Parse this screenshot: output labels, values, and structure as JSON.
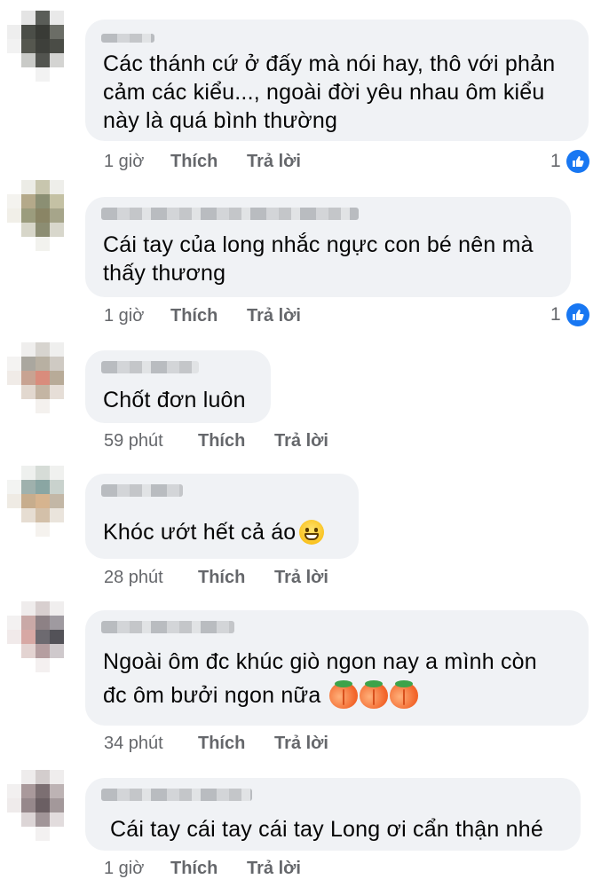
{
  "comments": [
    {
      "text_lines": [
        "Các thánh cứ ở đấy mà nói hay, thô với phản",
        "cảm các kiểu..., ngoài đời yêu nhau ôm kiểu",
        "này là quá bình thường"
      ],
      "time": "1 giờ",
      "like": "Thích",
      "reply": "Trả lời",
      "reactions": "1"
    },
    {
      "text_lines": [
        "Cái tay của long nhắc ngực con bé nên mà",
        "thấy thương"
      ],
      "time": "1 giờ",
      "like": "Thích",
      "reply": "Trả lời",
      "reactions": "1"
    },
    {
      "text_lines": [
        "Chốt đơn luôn"
      ],
      "time": "59 phút",
      "like": "Thích",
      "reply": "Trả lời"
    },
    {
      "text_lines": [
        "Khóc ướt hết cả áo"
      ],
      "emoji": "grinning-face",
      "time": "28 phút",
      "like": "Thích",
      "reply": "Trả lời"
    },
    {
      "text_lines": [
        "Ngoài ôm đc khúc giò ngon nay a mình còn",
        "đc ôm bưởi ngon nữa"
      ],
      "emoji": "peach",
      "time": "34 phút",
      "like": "Thích",
      "reply": "Trả lời"
    },
    {
      "text_lines": [
        "Cái tay cái tay cái tay Long ơi cẩn thận nhé"
      ],
      "time": "1 giờ",
      "like": "Thích",
      "reply": "Trả lời"
    }
  ],
  "colors": {
    "bubble": "#f0f2f5",
    "meta": "#65676b",
    "like_badge": "#1877f2"
  }
}
